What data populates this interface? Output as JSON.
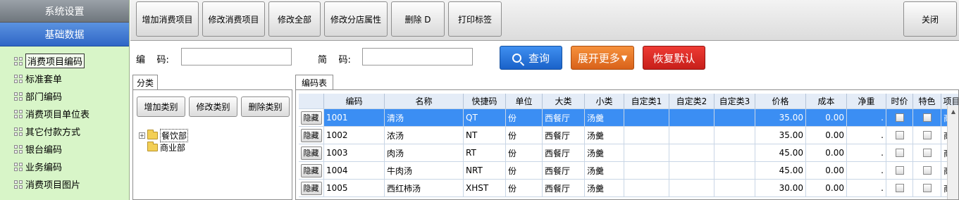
{
  "nav": {
    "system_label": "系统设置",
    "basic_label": "基础数据",
    "items": [
      {
        "label": "消费项目编码"
      },
      {
        "label": "标准套单"
      },
      {
        "label": "部门编码"
      },
      {
        "label": "消费项目单位表"
      },
      {
        "label": "其它付款方式"
      },
      {
        "label": "银台编码"
      },
      {
        "label": "业务编码"
      },
      {
        "label": "消费项目图片"
      }
    ]
  },
  "toolbar": {
    "add_item": "增加消费项目",
    "edit_item": "修改消费项目",
    "edit_all": "修改全部",
    "edit_branch": "修改分店属性",
    "delete": "删除 D",
    "print_label": "打印标签",
    "close": "关闭"
  },
  "search": {
    "code_label": "编    码:",
    "abbr_label": "简    码:",
    "code_value": "",
    "abbr_value": "",
    "query": "查询",
    "expand_more": "展开更多",
    "restore_default": "恢复默认"
  },
  "category": {
    "tab_label": "分类",
    "add": "增加类别",
    "edit": "修改类别",
    "delete": "删除类别",
    "tree": [
      {
        "label": "餐饮部",
        "expandable": "+"
      },
      {
        "label": "商业部"
      }
    ]
  },
  "grid": {
    "tab_label": "编码表",
    "columns": [
      "",
      "编码",
      "名称",
      "快捷码",
      "单位",
      "大类",
      "小类",
      "自定类1",
      "自定类2",
      "自定类3",
      "价格",
      "成本",
      "净重",
      "时价",
      "特色",
      "项目"
    ],
    "hide_label": "隐藏",
    "rows": [
      {
        "code": "1001",
        "name": "清汤",
        "quick": "QT",
        "unit": "份",
        "major": "西餐厅",
        "minor": "汤羹",
        "c1": "",
        "c2": "",
        "c3": "",
        "price": "35.00",
        "cost": "0.00",
        "weight": ".",
        "type": "商品"
      },
      {
        "code": "1002",
        "name": "浓汤",
        "quick": "NT",
        "unit": "份",
        "major": "西餐厅",
        "minor": "汤羹",
        "c1": "",
        "c2": "",
        "c3": "",
        "price": "35.00",
        "cost": "0.00",
        "weight": ".",
        "type": "商品"
      },
      {
        "code": "1003",
        "name": "肉汤",
        "quick": "RT",
        "unit": "份",
        "major": "西餐厅",
        "minor": "汤羹",
        "c1": "",
        "c2": "",
        "c3": "",
        "price": "45.00",
        "cost": "0.00",
        "weight": ".",
        "type": "商品"
      },
      {
        "code": "1004",
        "name": "牛肉汤",
        "quick": "NRT",
        "unit": "份",
        "major": "西餐厅",
        "minor": "汤羹",
        "c1": "",
        "c2": "",
        "c3": "",
        "price": "45.00",
        "cost": "0.00",
        "weight": ".",
        "type": "商品"
      },
      {
        "code": "1005",
        "name": "西红柿汤",
        "quick": "XHST",
        "unit": "份",
        "major": "西餐厅",
        "minor": "汤羹",
        "c1": "",
        "c2": "",
        "c3": "",
        "price": "30.00",
        "cost": "0.00",
        "weight": ".",
        "type": "商品"
      }
    ]
  },
  "colors": {
    "nav_bg": "#d8f5c8",
    "selected_row": "#3b8ef3",
    "query_btn": "#1a62c9",
    "more_btn": "#d9621a",
    "reset_btn": "#c71f1a"
  }
}
